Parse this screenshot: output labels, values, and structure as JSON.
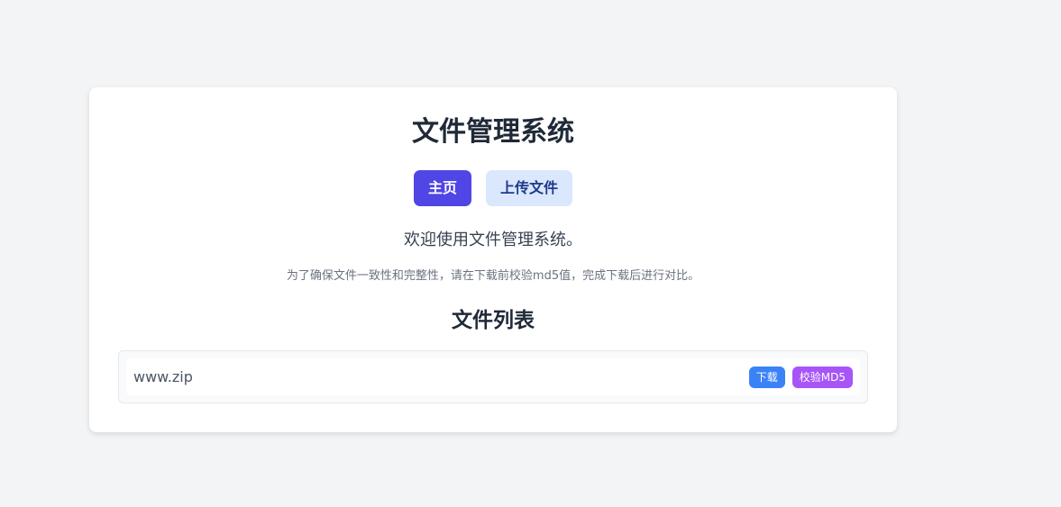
{
  "header": {
    "title": "文件管理系统"
  },
  "nav": {
    "home_label": "主页",
    "upload_label": "上传文件"
  },
  "intro": {
    "welcome": "欢迎使用文件管理系统。",
    "note": "为了确保文件一致性和完整性，请在下载前校验md5值，完成下载后进行对比。"
  },
  "files": {
    "title": "文件列表",
    "items": [
      {
        "name": "www.zip",
        "download_label": "下载",
        "md5_label": "校验MD5"
      }
    ]
  },
  "colors": {
    "primary": "#4f46e5",
    "secondary_bg": "#dbe7fd",
    "download": "#3b82f6",
    "md5": "#a855f7"
  }
}
